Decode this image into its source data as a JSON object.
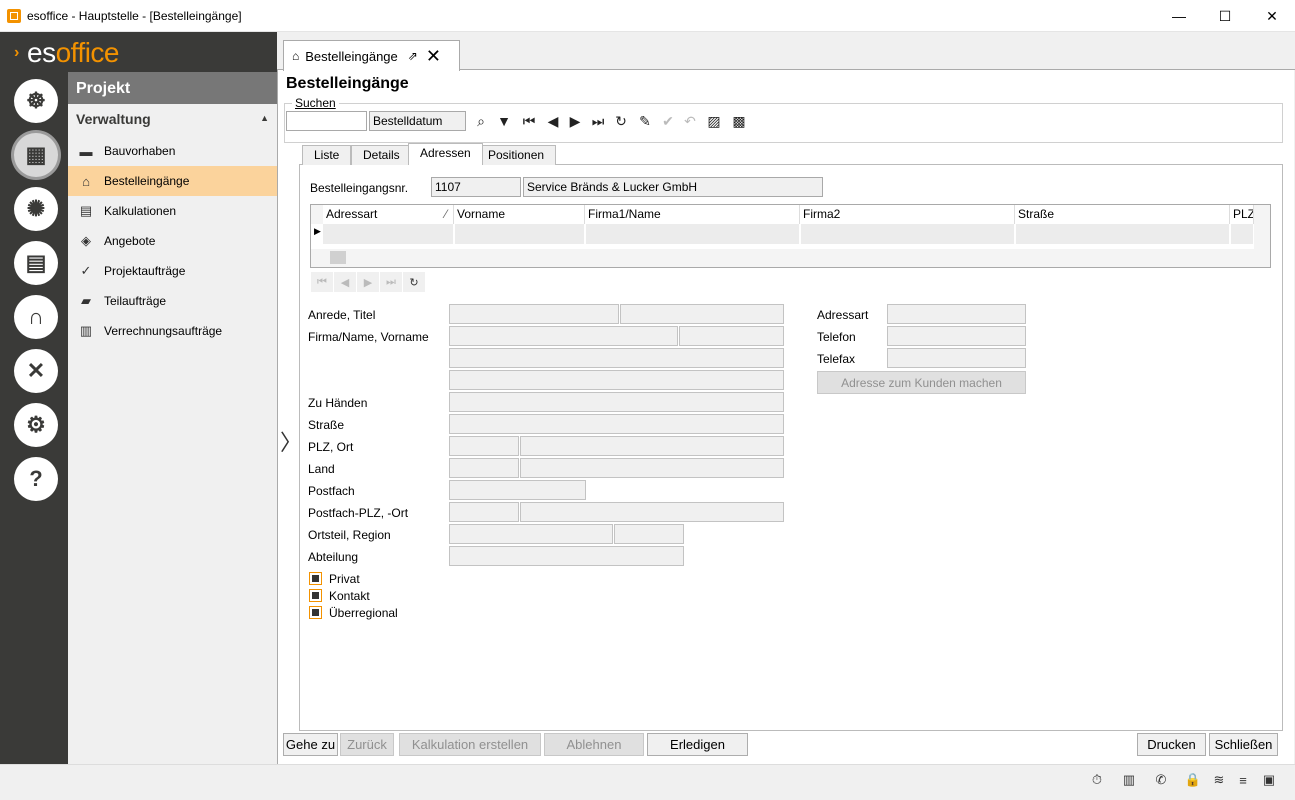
{
  "window": {
    "title": "esoffice - Hauptstelle - [Bestelleingänge]",
    "minimize": "—",
    "maximize": "☐",
    "close": "✕"
  },
  "brand": {
    "prefix": "es",
    "name": "office",
    "arrow": "›"
  },
  "rail": [
    {
      "name": "helm-icon",
      "glyph": "☸"
    },
    {
      "name": "project-icon",
      "glyph": "▦"
    },
    {
      "name": "alarm-icon",
      "glyph": "✺"
    },
    {
      "name": "money-icon",
      "glyph": "▤"
    },
    {
      "name": "headset-icon",
      "glyph": "∩"
    },
    {
      "name": "tools-icon",
      "glyph": "✕"
    },
    {
      "name": "settings-icon",
      "glyph": "⚙"
    },
    {
      "name": "help-icon",
      "glyph": "?"
    }
  ],
  "nav": {
    "header": "Projekt",
    "section": "Verwaltung",
    "section_caret": "▲",
    "items": [
      {
        "label": "Bauvorhaben",
        "icon": "▬"
      },
      {
        "label": "Bestelleingänge",
        "icon": "⌂"
      },
      {
        "label": "Kalkulationen",
        "icon": "▤"
      },
      {
        "label": "Angebote",
        "icon": "◈"
      },
      {
        "label": "Projektaufträge",
        "icon": "✓"
      },
      {
        "label": "Teilaufträge",
        "icon": "▰"
      },
      {
        "label": "Verrechnungsaufträge",
        "icon": "▥"
      }
    ]
  },
  "doctab": {
    "label": "Bestelleingänge",
    "icon": "⌂",
    "ext": "⇗",
    "close": "✕"
  },
  "page": {
    "title": "Bestelleingänge",
    "search_label": "Suchen",
    "search_value": "",
    "search_field": "Bestelldatum"
  },
  "toolbar": [
    {
      "name": "search-icon",
      "glyph": "⌕",
      "dis": false
    },
    {
      "name": "filter-icon",
      "glyph": "▼",
      "dis": false
    },
    {
      "name": "first-record-icon",
      "glyph": "⏮",
      "dis": false
    },
    {
      "name": "prev-record-icon",
      "glyph": "◀",
      "dis": false
    },
    {
      "name": "next-record-icon",
      "glyph": "▶",
      "dis": false
    },
    {
      "name": "last-record-icon",
      "glyph": "⏭",
      "dis": false
    },
    {
      "name": "refresh-icon",
      "glyph": "↻",
      "dis": false
    },
    {
      "name": "edit-icon",
      "glyph": "✎",
      "dis": false
    },
    {
      "name": "save-check-icon",
      "glyph": "✔",
      "dis": true
    },
    {
      "name": "undo-icon",
      "glyph": "↶",
      "dis": true
    },
    {
      "name": "filter-save-icon",
      "glyph": "▨",
      "dis": false
    },
    {
      "name": "filter-list-icon",
      "glyph": "▩",
      "dis": false
    }
  ],
  "tabs": [
    "Liste",
    "Details",
    "Adressen",
    "Positionen"
  ],
  "order": {
    "label": "Bestelleingangsnr.",
    "number": "1107",
    "customer": "Service Bränds & Lucker GmbH"
  },
  "grid": {
    "columns": [
      "Adressart",
      "Vorname",
      "Firma1/Name",
      "Firma2",
      "Straße",
      "PLZ"
    ],
    "sort_mark": "⁄",
    "row_pointer": "▶"
  },
  "recordnav": [
    {
      "name": "grid-first-icon",
      "glyph": "⏮"
    },
    {
      "name": "grid-prev-icon",
      "glyph": "◀"
    },
    {
      "name": "grid-next-icon",
      "glyph": "▶"
    },
    {
      "name": "grid-last-icon",
      "glyph": "⏭"
    },
    {
      "name": "grid-refresh-icon",
      "glyph": "↻"
    }
  ],
  "form": {
    "labels": {
      "anrede": "Anrede, Titel",
      "firma": "Firma/Name, Vorname",
      "zuhaenden": "Zu Händen",
      "strasse": "Straße",
      "plz": "PLZ, Ort",
      "land": "Land",
      "postfach": "Postfach",
      "postfach_plz": "Postfach-PLZ, -Ort",
      "ortsteil": "Ortsteil, Region",
      "abteilung": "Abteilung",
      "adressart": "Adressart",
      "telefon": "Telefon",
      "telefax": "Telefax"
    },
    "make_customer_button": "Adresse zum Kunden machen",
    "checkboxes": [
      "Privat",
      "Kontakt",
      "Überregional"
    ]
  },
  "buttons": {
    "gehe_zu": "Gehe zu",
    "zurueck": "Zurück",
    "kalkulation": "Kalkulation erstellen",
    "ablehnen": "Ablehnen",
    "erledigen": "Erledigen",
    "drucken": "Drucken",
    "schliessen": "Schließen"
  },
  "collapse_arrow": "〉",
  "statusbar": [
    {
      "name": "timer-icon",
      "glyph": "⏱"
    },
    {
      "name": "company-icon",
      "glyph": "▥"
    },
    {
      "name": "phone-icon",
      "glyph": "✆"
    },
    {
      "name": "lock-icon",
      "glyph": "🔒"
    },
    {
      "name": "database-icon",
      "glyph": "≋"
    },
    {
      "name": "log-icon",
      "glyph": "≡"
    },
    {
      "name": "sql-icon",
      "glyph": "▣"
    }
  ]
}
